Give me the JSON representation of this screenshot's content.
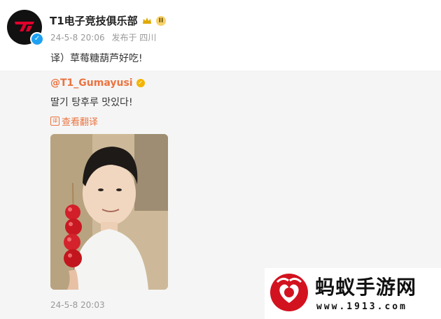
{
  "post": {
    "author": "T1电子竞技俱乐部",
    "badge": "II",
    "timestamp": "24-5-8 20:06",
    "location": "发布于 四川",
    "text": "译）草莓糖葫芦好吃!"
  },
  "quoted": {
    "author": "@T1_Gumayusi",
    "text": "딸기 탕후루 맛있다!",
    "translate_label": "查看翻译",
    "timestamp": "24-5-8 20:03"
  },
  "watermark": {
    "title": "蚂蚁手游网",
    "url": "www.1913.com"
  },
  "colors": {
    "link": "#eb7340",
    "verified": "#1da1f2",
    "meta": "#999999"
  },
  "icons": [
    "t1-logo",
    "verified-icon",
    "crown-badge-icon",
    "gold-verified-icon",
    "translate-icon"
  ]
}
